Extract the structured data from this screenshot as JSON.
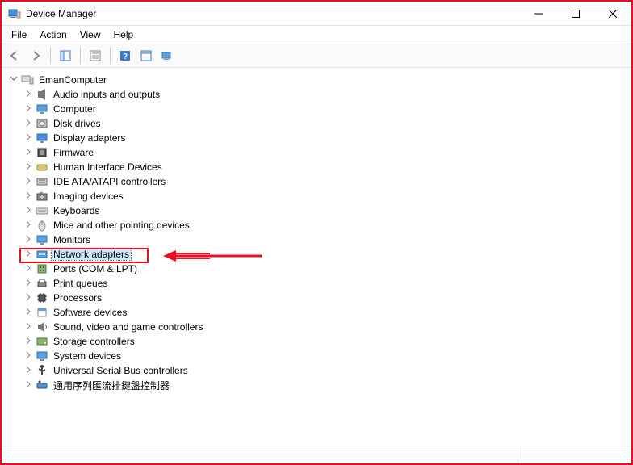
{
  "window": {
    "title": "Device Manager"
  },
  "menu": {
    "file": "File",
    "action": "Action",
    "view": "View",
    "help": "Help"
  },
  "tree": {
    "root": {
      "label": "EmanComputer",
      "expanded": true
    },
    "items": [
      {
        "label": "Audio inputs and outputs",
        "icon": "audio"
      },
      {
        "label": "Computer",
        "icon": "computer"
      },
      {
        "label": "Disk drives",
        "icon": "disk"
      },
      {
        "label": "Display adapters",
        "icon": "display"
      },
      {
        "label": "Firmware",
        "icon": "firmware"
      },
      {
        "label": "Human Interface Devices",
        "icon": "hid"
      },
      {
        "label": "IDE ATA/ATAPI controllers",
        "icon": "ide"
      },
      {
        "label": "Imaging devices",
        "icon": "imaging"
      },
      {
        "label": "Keyboards",
        "icon": "keyboard"
      },
      {
        "label": "Mice and other pointing devices",
        "icon": "mouse"
      },
      {
        "label": "Monitors",
        "icon": "monitor"
      },
      {
        "label": "Network adapters",
        "icon": "network",
        "selected": true,
        "highlighted": true
      },
      {
        "label": "Ports (COM & LPT)",
        "icon": "ports"
      },
      {
        "label": "Print queues",
        "icon": "print"
      },
      {
        "label": "Processors",
        "icon": "cpu"
      },
      {
        "label": "Software devices",
        "icon": "software"
      },
      {
        "label": "Sound, video and game controllers",
        "icon": "sound"
      },
      {
        "label": "Storage controllers",
        "icon": "storage"
      },
      {
        "label": "System devices",
        "icon": "system"
      },
      {
        "label": "Universal Serial Bus controllers",
        "icon": "usb"
      },
      {
        "label": "通用序列匯流排鍵盤控制器",
        "icon": "usb-kbd"
      }
    ]
  }
}
